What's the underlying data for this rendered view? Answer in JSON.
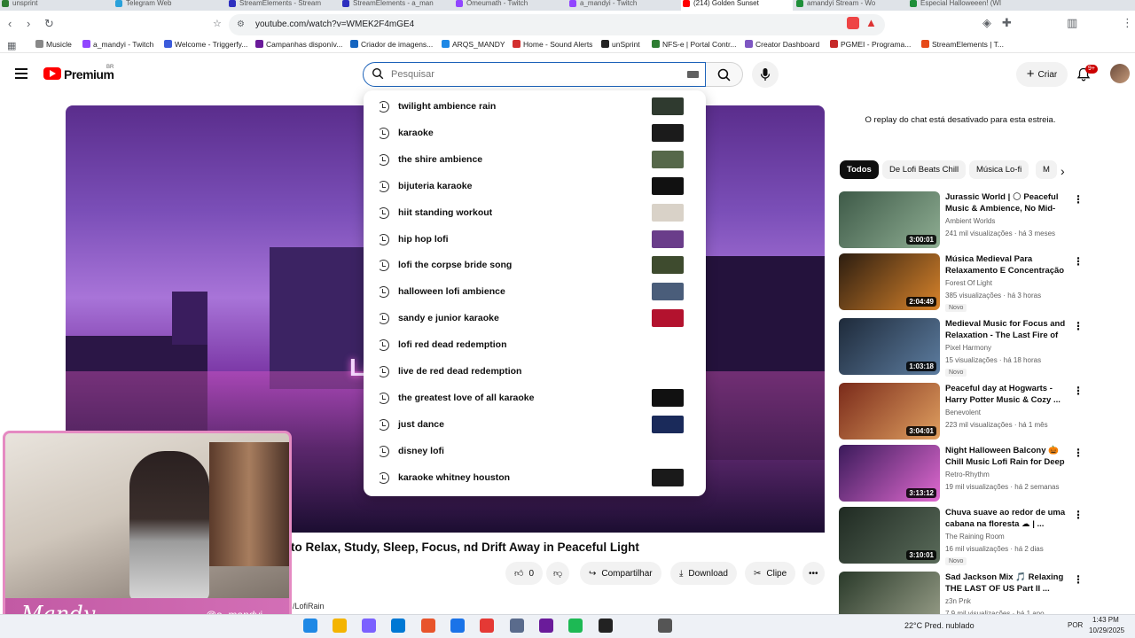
{
  "browser": {
    "tabs": [
      {
        "label": "unsprint",
        "color": "#2e7d32"
      },
      {
        "label": "Telegram Web",
        "color": "#2aa1da"
      },
      {
        "label": "StreamElements - Stream",
        "color": "#2d2fbf"
      },
      {
        "label": "StreamElements - a_man",
        "color": "#2d2fbf"
      },
      {
        "label": "Omeumath - Twitch",
        "color": "#9146ff"
      },
      {
        "label": "a_mandyi - Twitch",
        "color": "#9146ff"
      },
      {
        "label": "(214) Golden Sunset",
        "color": "#ff0000"
      },
      {
        "label": "amandyi Stream - Wo",
        "color": "#1f8f3a"
      },
      {
        "label": "Especial Halloweeen! (WI",
        "color": "#1f8f3a"
      }
    ],
    "url": "youtube.com/watch?v=WMEK2F4mGE4",
    "bookmarks": [
      {
        "label": "Musicle",
        "color": "#888888"
      },
      {
        "label": "a_mandyi - Twitch",
        "color": "#9146ff"
      },
      {
        "label": "Welcome - Triggerfy...",
        "color": "#3b5bdb"
      },
      {
        "label": "Campanhas disponív...",
        "color": "#6a1b9a"
      },
      {
        "label": "Criador de imagens...",
        "color": "#1565c0"
      },
      {
        "label": "ARQS_MANDY",
        "color": "#1e88e5"
      },
      {
        "label": "Home - Sound Alerts",
        "color": "#d32f2f"
      },
      {
        "label": "unSprint",
        "color": "#222222"
      },
      {
        "label": "NFS-e | Portal Contr...",
        "color": "#2e7d32"
      },
      {
        "label": "Creator Dashboard",
        "color": "#7e57c2"
      },
      {
        "label": "PGMEI - Programa...",
        "color": "#c62828"
      },
      {
        "label": "StreamElements | T...",
        "color": "#e64a19"
      }
    ]
  },
  "yt": {
    "brand": "Premium",
    "country": "BR",
    "search_placeholder": "Pesquisar",
    "create_label": "Criar",
    "notif_count": "9+"
  },
  "suggestions": [
    {
      "text": "twilight ambience rain",
      "thumb": "#2f3a2f"
    },
    {
      "text": "karaoke",
      "thumb": "#1b1b1b"
    },
    {
      "text": "the shire ambience",
      "thumb": "#56684a"
    },
    {
      "text": "bijuteria karaoke",
      "thumb": "#111111"
    },
    {
      "text": "hiit standing workout",
      "thumb": "#d9d2c8"
    },
    {
      "text": "hip hop lofi",
      "thumb": "#6a3d8a"
    },
    {
      "text": "lofi the corpse bride song",
      "thumb": "#3e4b2e"
    },
    {
      "text": "halloween lofi ambience",
      "thumb": "#4a5d7a"
    },
    {
      "text": "sandy e junior karaoke",
      "thumb": "#b3122e"
    },
    {
      "text": "lofi red dead redemption",
      "thumb": ""
    },
    {
      "text": "live de red dead redemption",
      "thumb": ""
    },
    {
      "text": "the greatest love of all karaoke",
      "thumb": "#111111"
    },
    {
      "text": "just dance",
      "thumb": "#1a2a5a"
    },
    {
      "text": "disney lofi",
      "thumb": ""
    },
    {
      "text": "karaoke whitney houston",
      "thumb": "#1a1a1a"
    }
  ],
  "video": {
    "sign": "Lo",
    "title": "to Relax, Study, Sleep, Focus, nd Drift Away in Peaceful Light",
    "like_count": "0",
    "share_label": "Compartilhar",
    "download_label": "Download",
    "clip_label": "Clipe",
    "channel_tag": "/LofiRain"
  },
  "sidebar": {
    "chat_note": "O replay do chat está desativado para esta estreia.",
    "chips": [
      "Todos",
      "De Lofi Beats Chill",
      "Música Lo-fi",
      "M"
    ],
    "recs": [
      {
        "title": "Jurassic World | 🌕 Peaceful Music & Ambience, No Mid-rol...",
        "channel": "Ambient Worlds",
        "meta": "241 mil visualizações · há 3 meses",
        "duration": "3:00:01",
        "new": "",
        "thumb_a": "#3e5a48",
        "thumb_b": "#8fae93"
      },
      {
        "title": "Música Medieval Para Relaxamento E Concentração |...",
        "channel": "Forest Of Light",
        "meta": "385 visualizações · há 3 horas",
        "duration": "2:04:49",
        "new": "Novo",
        "thumb_a": "#2c1d10",
        "thumb_b": "#d9842b"
      },
      {
        "title": "Medieval Music for Focus and Relaxation - The Last Fire of th...",
        "channel": "Pixel Harmony",
        "meta": "15 visualizações · há 18 horas",
        "duration": "1:03:18",
        "new": "Novo",
        "thumb_a": "#1e2a3a",
        "thumb_b": "#5d7da0"
      },
      {
        "title": "Peaceful day at Hogwarts - Harry Potter Music & Cozy ...",
        "channel": "Benevolent",
        "meta": "223 mil visualizações · há 1 mês",
        "duration": "3:04:01",
        "new": "",
        "thumb_a": "#7a2a1a",
        "thumb_b": "#e0a060"
      },
      {
        "title": "Night Halloween Balcony 🎃 Chill Music Lofi Rain for Deep ...",
        "channel": "Retro-Rhythm",
        "meta": "19 mil visualizações · há 2 semanas",
        "duration": "3:13:12",
        "new": "",
        "thumb_a": "#3a1a5a",
        "thumb_b": "#e06ad0"
      },
      {
        "title": "Chuva suave ao redor de uma cabana na floresta ☁ | ...",
        "channel": "The Raining Room",
        "meta": "16 mil visualizações · há 2 dias",
        "duration": "3:10:01",
        "new": "Novo",
        "thumb_a": "#1f2a22",
        "thumb_b": "#5a6b5a"
      },
      {
        "title": "Sad Jackson Mix 🎵 Relaxing THE LAST OF US Part II ...",
        "channel": "z3n Pnk",
        "meta": "7,9 mil visualizações · há 1 ano",
        "duration": "",
        "new": "",
        "thumb_a": "#2a3a2a",
        "thumb_b": "#9aa08a"
      }
    ]
  },
  "webcam": {
    "name": "Mandy",
    "handle": "@a_mandyi"
  },
  "taskbar": {
    "weather": "22°C  Pred. nublado",
    "lang": "POR",
    "time": "1:43 PM",
    "date": "10/29/2025",
    "apps": [
      "#1e88e5",
      "#f4b400",
      "#7b61ff",
      "#0078d4",
      "#e8542b",
      "#1a73e8",
      "#e53935",
      "#5a6b8c",
      "#6a1b9a",
      "#1db954",
      "#222222",
      "#555555"
    ]
  }
}
